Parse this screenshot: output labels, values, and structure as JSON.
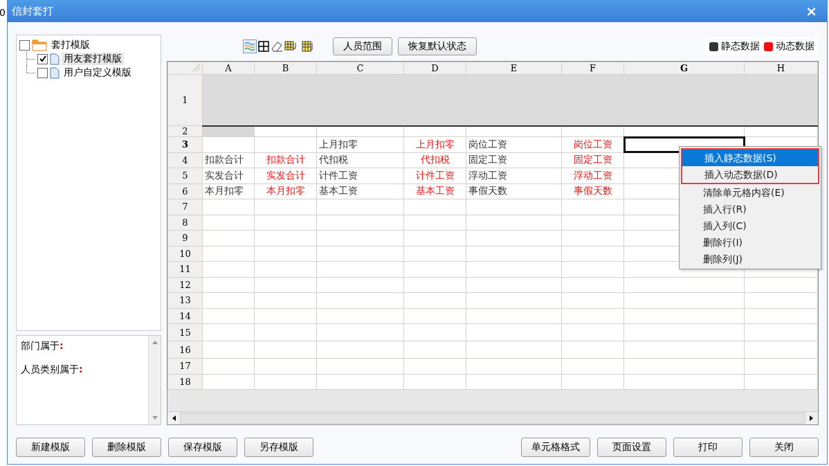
{
  "background_text": "0",
  "window": {
    "title": "信封套打",
    "close": "×"
  },
  "tree": [
    {
      "label": "套打模版",
      "checked": false,
      "selected": false,
      "expanded": true,
      "children": [
        {
          "label": "用友套打模版",
          "checked": true,
          "selected": true
        },
        {
          "label": "用户自定义模版",
          "checked": false,
          "selected": false
        }
      ]
    }
  ],
  "filters": [
    {
      "label": "部门属于",
      "separator": ":"
    },
    {
      "label": "人员类别属于",
      "separator": ":"
    }
  ],
  "toolbar": {
    "buttons": [
      "人员范围",
      "恢复默认状态"
    ]
  },
  "legend": [
    {
      "label": "静态数据",
      "color": "#333333"
    },
    {
      "label": "动态数据",
      "color": "#ee1111"
    }
  ],
  "sheet": {
    "columns": [
      {
        "name": "A",
        "selected": false
      },
      {
        "name": "B",
        "selected": false
      },
      {
        "name": "C",
        "selected": false
      },
      {
        "name": "D",
        "selected": false
      },
      {
        "name": "E",
        "selected": false
      },
      {
        "name": "F",
        "selected": false
      },
      {
        "name": "G",
        "selected": true
      },
      {
        "name": "H",
        "selected": false
      }
    ],
    "rows": [
      {
        "number": "1",
        "selected": false,
        "shaded": true
      },
      {
        "number": "2",
        "selected": false,
        "cells": [
          {
            "shaded": true
          }
        ]
      },
      {
        "number": "3",
        "selected": true,
        "cells": [
          null,
          null,
          {
            "text": "上月扣零",
            "kind": "static"
          },
          {
            "text": "上月扣零",
            "kind": "dynamic"
          },
          {
            "text": "岗位工资",
            "kind": "static"
          },
          {
            "text": "岗位工资",
            "kind": "dynamic"
          }
        ]
      },
      {
        "number": "4",
        "selected": false,
        "cells": [
          {
            "text": "扣款合计",
            "kind": "static"
          },
          {
            "text": "扣款合计",
            "kind": "dynamic"
          },
          {
            "text": "代扣税",
            "kind": "static"
          },
          {
            "text": "代扣税",
            "kind": "dynamic"
          },
          {
            "text": "固定工资",
            "kind": "static"
          },
          {
            "text": "固定工资",
            "kind": "dynamic"
          }
        ]
      },
      {
        "number": "5",
        "selected": false,
        "cells": [
          {
            "text": "实发合计",
            "kind": "static"
          },
          {
            "text": "实发合计",
            "kind": "dynamic"
          },
          {
            "text": "计件工资",
            "kind": "static"
          },
          {
            "text": "计件工资",
            "kind": "dynamic"
          },
          {
            "text": "浮动工资",
            "kind": "static"
          },
          {
            "text": "浮动工资",
            "kind": "dynamic"
          }
        ]
      },
      {
        "number": "6",
        "selected": false,
        "cells": [
          {
            "text": "本月扣零",
            "kind": "static"
          },
          {
            "text": "本月扣零",
            "kind": "dynamic"
          },
          {
            "text": "基本工资",
            "kind": "static"
          },
          {
            "text": "基本工资",
            "kind": "dynamic"
          },
          {
            "text": "事假天数",
            "kind": "static"
          },
          {
            "text": "事假天数",
            "kind": "dynamic"
          }
        ]
      },
      {
        "number": "7",
        "selected": false
      },
      {
        "number": "8",
        "selected": false
      },
      {
        "number": "9",
        "selected": false
      },
      {
        "number": "10",
        "selected": false
      },
      {
        "number": "11",
        "selected": false
      },
      {
        "number": "12",
        "selected": false
      },
      {
        "number": "13",
        "selected": false
      },
      {
        "number": "14",
        "selected": false
      },
      {
        "number": "15",
        "selected": false
      },
      {
        "number": "16",
        "selected": false
      },
      {
        "number": "17",
        "selected": false
      },
      {
        "number": "18",
        "selected": false
      }
    ]
  },
  "context_menu": [
    {
      "label": "插入静态数据(S)",
      "selected": true,
      "outlined": true
    },
    {
      "label": "插入动态数据(D)",
      "selected": false,
      "outlined": true
    },
    {
      "label": "清除单元格内容(E)",
      "selected": false,
      "outlined": false
    },
    {
      "label": "插入行(R)",
      "selected": false,
      "outlined": false
    },
    {
      "label": "插入列(C)",
      "selected": false,
      "outlined": false
    },
    {
      "label": "删除行(I)",
      "selected": false,
      "outlined": false
    },
    {
      "label": "删除列(J)",
      "selected": false,
      "outlined": false
    }
  ],
  "footer": {
    "left_buttons": [
      "新建模版",
      "删除模版",
      "保存模版",
      "另存模版"
    ],
    "right_buttons": [
      "单元格格式",
      "页面设置",
      "打印",
      "关闭"
    ]
  }
}
